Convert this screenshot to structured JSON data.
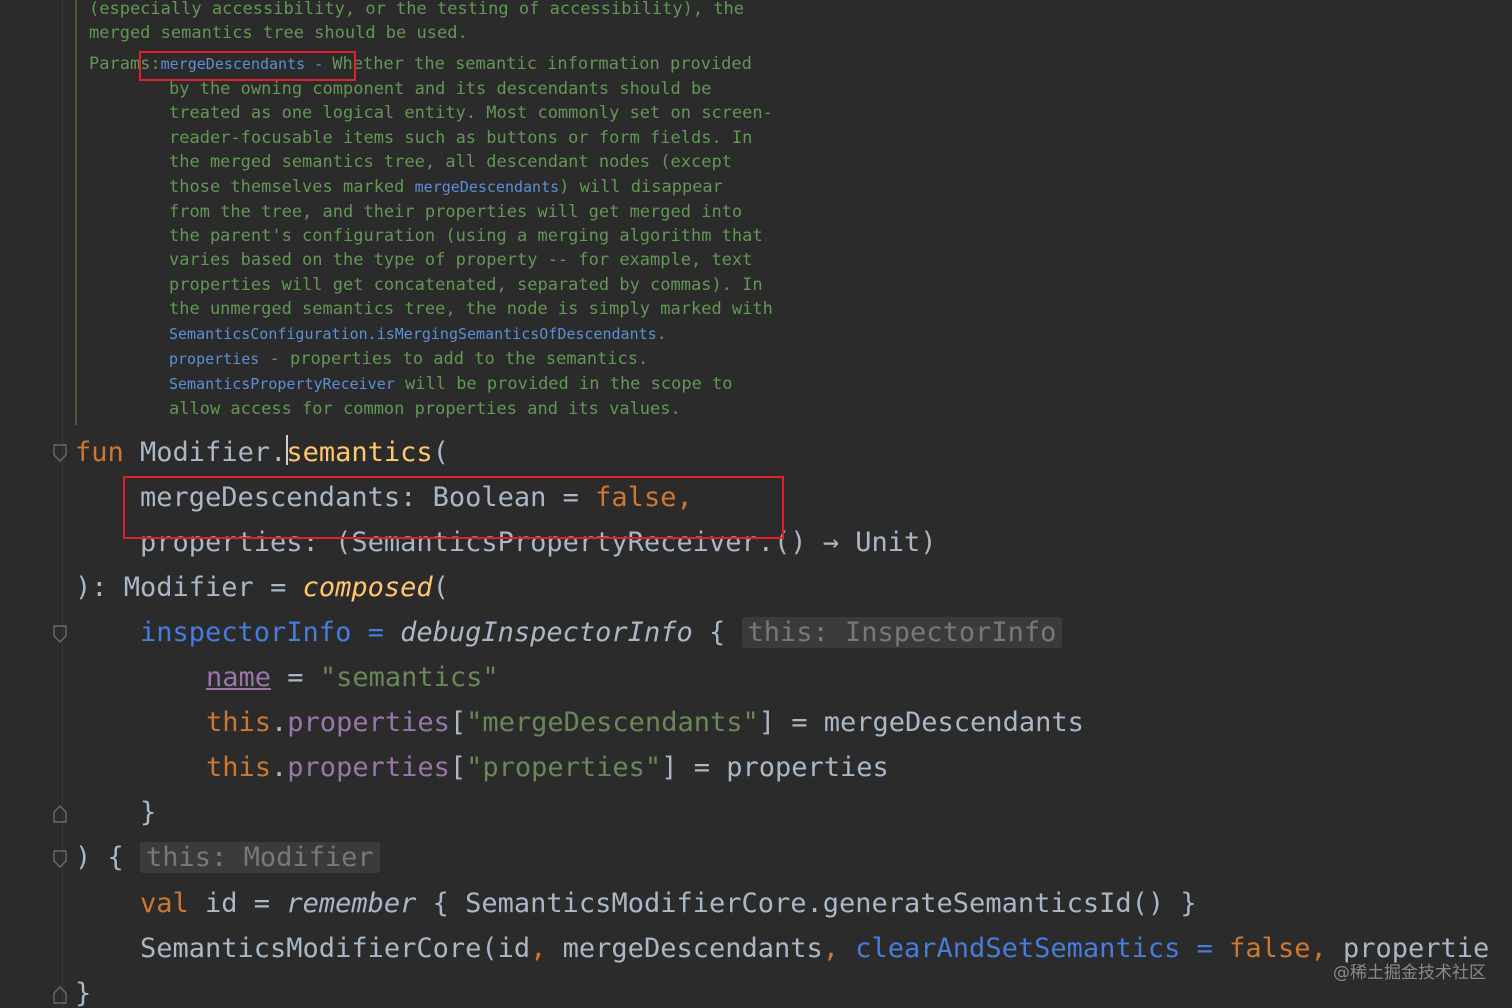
{
  "doc": {
    "line1": "(especially accessibility, or the testing of accessibility), the",
    "line2": "merged semantics tree should be used.",
    "params_label": "Params:",
    "param1_name": "mergeDescendants",
    "param1_dash": " - ",
    "param1_text": [
      "Whether the semantic information provided",
      "by the owning component and its descendants should be",
      "treated as one logical entity. Most commonly set on screen-",
      "reader-focusable items such as buttons or form fields. In",
      "the merged semantics tree, all descendant nodes (except"
    ],
    "line_those_a": "those themselves marked ",
    "line_those_link": "mergeDescendants",
    "line_those_b": ") will disappear",
    "param1_text2": [
      "from the tree, and their properties will get merged into",
      "the parent's configuration (using a merging algorithm that",
      "varies based on the type of property -- for example, text",
      "properties will get concatenated, separated by commas). In",
      "the unmerged semantics tree, the node is simply marked with"
    ],
    "link_config": "SemanticsConfiguration.isMergingSemanticsOfDescendants",
    "link_config_end": ".",
    "param2_name": "properties",
    "param2_text": " - properties to add to the semantics.",
    "link_receiver": "SemanticsPropertyReceiver",
    "receiver_text": " will be provided in the scope to",
    "last_line": "allow access for common properties and its values."
  },
  "code": {
    "fun_kw": "fun",
    "receiver": " Modifier.",
    "fn_name": "semantics",
    "open_paren": "(",
    "p1_name": "mergeDescendants",
    "p1_type": ": Boolean = ",
    "p1_default": "false",
    "p1_comma": ",",
    "p2": "properties: (SemanticsPropertyReceiver.() → Unit)",
    "ret_a": "): Modifier = ",
    "composed": "composed",
    "inspector_prop": "inspectorInfo",
    "inspector_eq": " = ",
    "debug_fn": "debugInspectorInfo",
    "brace_open": " { ",
    "hint_inspector": "this: InspectorInfo",
    "name_prop": "name",
    "name_eq": " = ",
    "name_val": "\"semantics\"",
    "this_kw": "this",
    "dot": ".",
    "properties_prop": "properties",
    "bracket_open": "[",
    "key1": "\"mergeDescendants\"",
    "assign1": "] = mergeDescendants",
    "key2": "\"properties\"",
    "assign2": "] = properties",
    "close_brace": "}",
    "lambda_open": ") { ",
    "hint_modifier": "this: Modifier",
    "val_kw": "val",
    "id_decl": " id = ",
    "remember_fn": "remember",
    "remember_body": " { SemanticsModifierCore.generateSemanticsId() }",
    "core_call": "SemanticsModifierCore(id",
    "comma": ",",
    "core_arg2": " mergeDescendants",
    "clear_arg": " clearAndSetSemantics",
    "clear_eq": " = ",
    "false_kw": "false",
    "properties_tail": " propertie",
    "final_brace": "}"
  },
  "watermark": "@稀土掘金技术社区"
}
